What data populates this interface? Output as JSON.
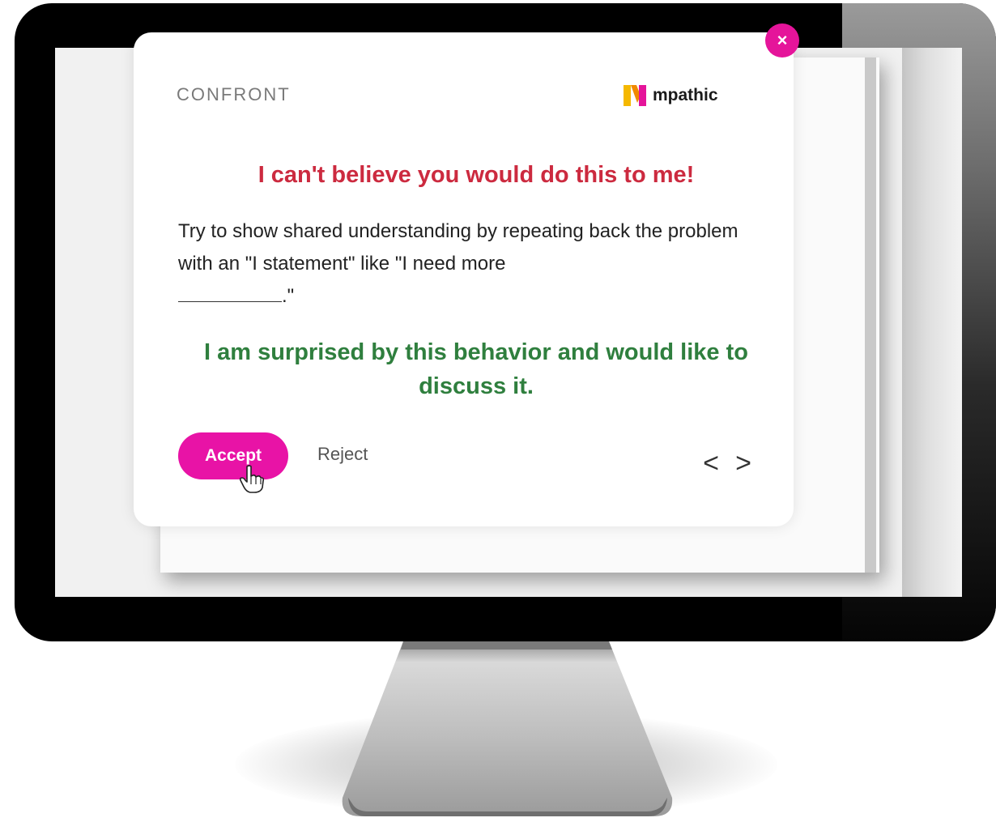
{
  "card": {
    "category": "CONFRONT",
    "brand_name": "mpathic",
    "close_symbol": "×",
    "original_message": "I can't believe you would do this to me!",
    "suggestion_part1": "Try to show shared understanding by repeating back the problem with an \"I statement\" like \"I need more",
    "suggestion_part2": ".\"",
    "rewrite": "I am surprised by this behavior and would like to discuss it.",
    "accept_label": "Accept",
    "reject_label": "Reject",
    "prev_symbol": "<",
    "next_symbol": ">"
  },
  "icons": {
    "close": "close-icon",
    "brand": "mpathic-logo-icon",
    "cursor": "hand-pointer-icon",
    "prev": "chevron-left-icon",
    "next": "chevron-right-icon"
  },
  "colors": {
    "accent": "#e813a6",
    "original_message": "#cc2a3f",
    "rewrite": "#2f7f3e",
    "brand_yellow": "#f5b800",
    "brand_pink": "#e5149a"
  }
}
